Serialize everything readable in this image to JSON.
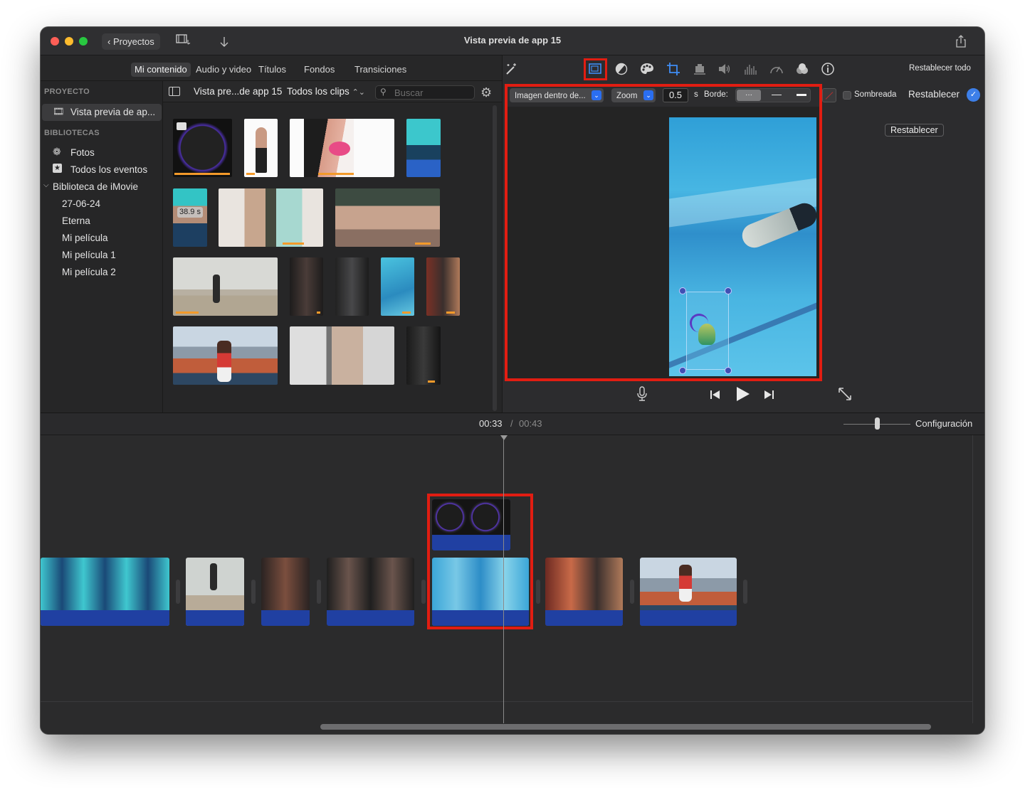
{
  "window": {
    "title": "Vista previa de app 15",
    "back_button": "Proyectos"
  },
  "browser_tabs": [
    {
      "label": "Mi contenido",
      "active": true
    },
    {
      "label": "Audio y video",
      "active": false
    },
    {
      "label": "Títulos",
      "active": false
    },
    {
      "label": "Fondos",
      "active": false
    },
    {
      "label": "Transiciones",
      "active": false
    }
  ],
  "sidebar": {
    "project_heading": "PROYECTO",
    "project_item": "Vista previa de ap...",
    "libraries_heading": "BIBLIOTECAS",
    "items": [
      {
        "label": "Fotos",
        "icon": "flower-icon"
      },
      {
        "label": "Todos los eventos",
        "icon": "star-icon"
      },
      {
        "label": "Biblioteca de iMovie",
        "icon": "chevron-down-icon"
      },
      {
        "label": "27-06-24"
      },
      {
        "label": "Eterna"
      },
      {
        "label": "Mi película"
      },
      {
        "label": "Mi película 1"
      },
      {
        "label": "Mi película 2"
      }
    ]
  },
  "browser": {
    "project_name": "Vista pre...de app 15",
    "filter": "Todos los clips",
    "search_placeholder": "Buscar",
    "duration_badge": "38.9 s"
  },
  "viewer": {
    "reset_all": "Restablecer todo",
    "overlay_mode": "Imagen dentro de...",
    "transition": "Zoom",
    "duration_value": "0.5",
    "duration_unit": "s",
    "border_label": "Borde:",
    "shadow_label": "Sombreada",
    "reset_label": "Restablecer",
    "reset_button": "Restablecer"
  },
  "timeline": {
    "current_time": "00:33",
    "separator": "/",
    "total_time": "00:43",
    "settings": "Configuración"
  },
  "colors": {
    "highlight_red": "#e11d12",
    "accent_blue": "#2a6ef0",
    "clip_blue": "#2040a2",
    "orange_bar": "#f39a2a"
  }
}
